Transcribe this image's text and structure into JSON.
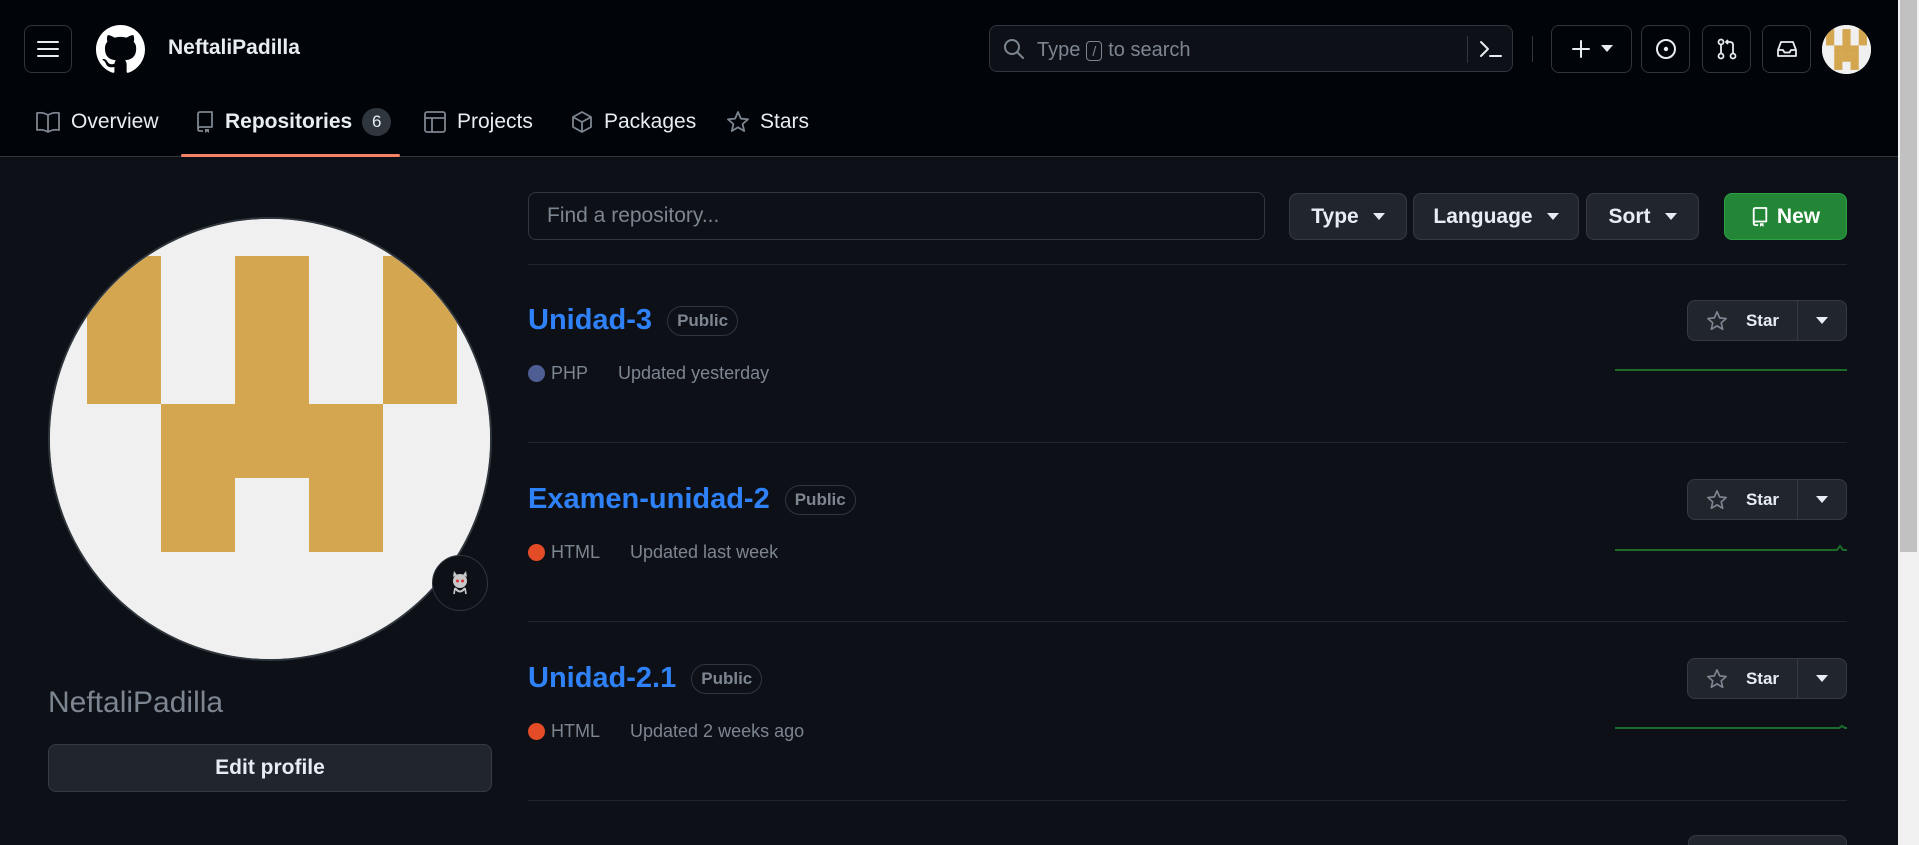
{
  "header": {
    "username": "NeftaliPadilla",
    "search": {
      "prefix": "Type",
      "key": "/",
      "suffix": "to search"
    }
  },
  "nav": {
    "tabs": [
      {
        "label": "Overview",
        "icon": "book-icon"
      },
      {
        "label": "Repositories",
        "icon": "repo-icon",
        "count": "6",
        "active": true
      },
      {
        "label": "Projects",
        "icon": "table-icon"
      },
      {
        "label": "Packages",
        "icon": "package-icon"
      },
      {
        "label": "Stars",
        "icon": "star-icon"
      }
    ]
  },
  "profile": {
    "name": "NeftaliPadilla",
    "edit_label": "Edit profile"
  },
  "filters": {
    "find_placeholder": "Find a repository...",
    "type_label": "Type",
    "language_label": "Language",
    "sort_label": "Sort",
    "new_label": "New"
  },
  "repos": [
    {
      "name": "Unidad-3",
      "visibility": "Public",
      "language": "PHP",
      "language_color": "#4f5d95",
      "updated": "Updated yesterday",
      "star_label": "Star"
    },
    {
      "name": "Examen-unidad-2",
      "visibility": "Public",
      "language": "HTML",
      "language_color": "#e34c26",
      "updated": "Updated last week",
      "star_label": "Star"
    },
    {
      "name": "Unidad-2.1",
      "visibility": "Public",
      "language": "HTML",
      "language_color": "#e34c26",
      "updated": "Updated 2 weeks ago",
      "star_label": "Star"
    }
  ],
  "colors": {
    "accent_link": "#2f81f7",
    "primary_button": "#238636",
    "tab_underline": "#f78166",
    "avatar_gold": "#d4a64f"
  }
}
